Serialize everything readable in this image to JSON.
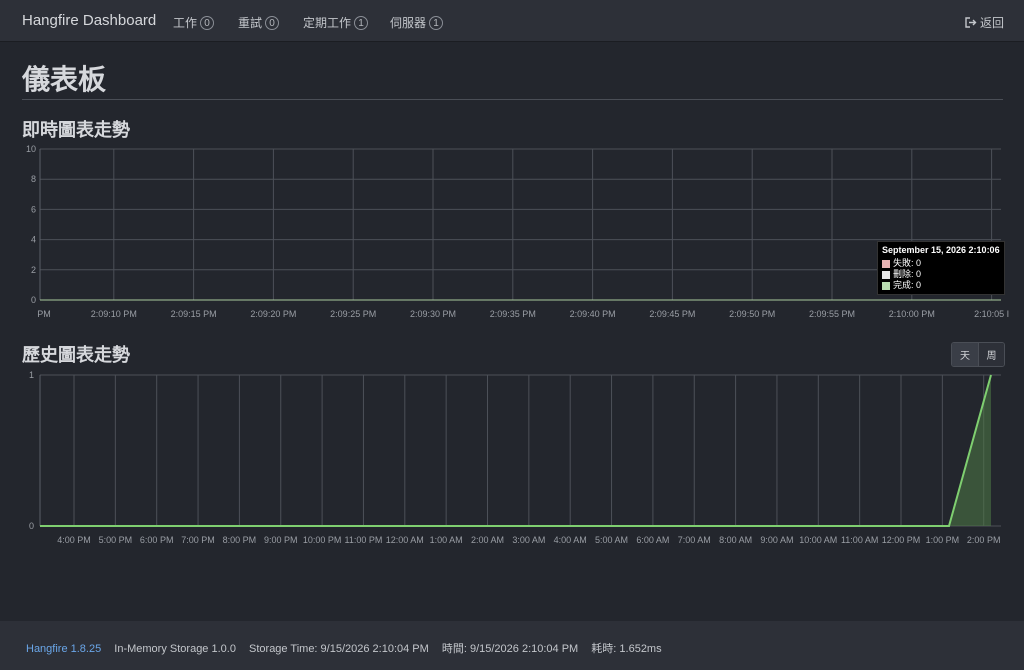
{
  "navbar": {
    "brand": "Hangfire Dashboard",
    "items": [
      {
        "label": "工作",
        "count": "0"
      },
      {
        "label": "重試",
        "count": "0"
      },
      {
        "label": "定期工作",
        "count": "1"
      },
      {
        "label": "伺服器",
        "count": "1"
      }
    ],
    "logout_label": "返回"
  },
  "page_title": "儀表板",
  "realtime": {
    "title": "即時圖表走勢",
    "tooltip": {
      "title": "September 15, 2026 2:10:06",
      "rows": [
        {
          "label": "失敗: 0",
          "color": "#e8b4b4"
        },
        {
          "label": "刪除: 0",
          "color": "#e6e6e6"
        },
        {
          "label": "完成: 0",
          "color": "#b8dcb0"
        }
      ]
    }
  },
  "history": {
    "title": "歷史圖表走勢",
    "toggle": {
      "day": "天",
      "week": "周"
    }
  },
  "chart_data": [
    {
      "type": "line",
      "title": "即時圖表走勢",
      "ylim": [
        0,
        10
      ],
      "yticks": [
        "0",
        "2",
        "4",
        "6",
        "8",
        "10"
      ],
      "x": [
        "PM",
        "2:09:10 PM",
        "2:09:15 PM",
        "2:09:20 PM",
        "2:09:25 PM",
        "2:09:30 PM",
        "2:09:35 PM",
        "2:09:40 PM",
        "2:09:45 PM",
        "2:09:50 PM",
        "2:09:55 PM",
        "2:10:00 PM",
        "2:10:05 I"
      ],
      "series": [
        {
          "name": "失敗",
          "values": [
            0,
            0,
            0,
            0,
            0,
            0,
            0,
            0,
            0,
            0,
            0,
            0,
            0
          ]
        },
        {
          "name": "刪除",
          "values": [
            0,
            0,
            0,
            0,
            0,
            0,
            0,
            0,
            0,
            0,
            0,
            0,
            0
          ]
        },
        {
          "name": "完成",
          "values": [
            0,
            0,
            0,
            0,
            0,
            0,
            0,
            0,
            0,
            0,
            0,
            0,
            0
          ]
        }
      ],
      "grid": true
    },
    {
      "type": "area",
      "title": "歷史圖表走勢",
      "ylim": [
        0,
        1
      ],
      "yticks": [
        "0",
        "1"
      ],
      "x": [
        "4:00 PM",
        "5:00 PM",
        "6:00 PM",
        "7:00 PM",
        "8:00 PM",
        "9:00 PM",
        "10:00 PM",
        "11:00 PM",
        "12:00 AM",
        "1:00 AM",
        "2:00 AM",
        "3:00 AM",
        "4:00 AM",
        "5:00 AM",
        "6:00 AM",
        "7:00 AM",
        "8:00 AM",
        "9:00 AM",
        "10:00 AM",
        "11:00 AM",
        "12:00 PM",
        "1:00 PM",
        "2:00 PM"
      ],
      "series": [
        {
          "name": "完成",
          "values": [
            0,
            0,
            0,
            0,
            0,
            0,
            0,
            0,
            0,
            0,
            0,
            0,
            0,
            0,
            0,
            0,
            0,
            0,
            0,
            0,
            0,
            0,
            0,
            1
          ]
        }
      ],
      "grid": true
    }
  ],
  "footer": {
    "version": "Hangfire 1.8.25",
    "storage": "In-Memory Storage 1.0.0",
    "storage_time": "Storage Time: 9/15/2026 2:10:04 PM",
    "time": "時間:  9/15/2026 2:10:04 PM",
    "elapsed": "耗時:  1.652ms"
  }
}
